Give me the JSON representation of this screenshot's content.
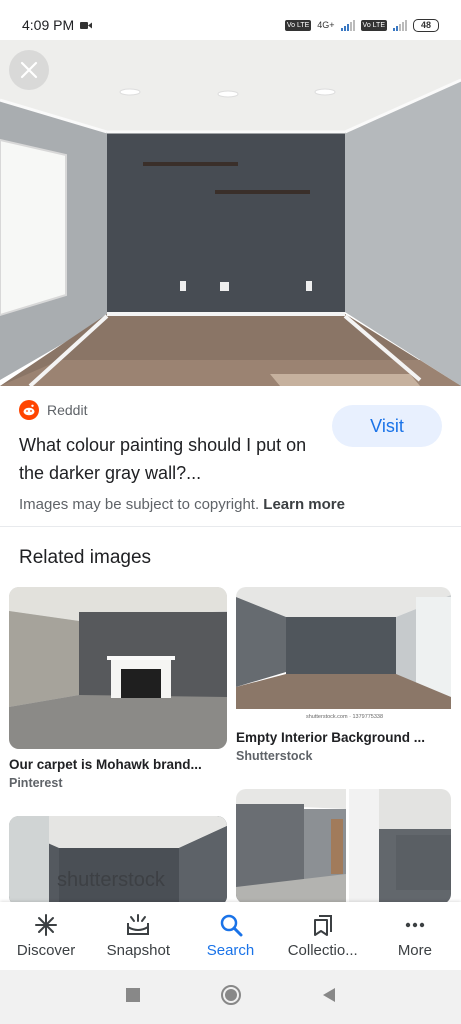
{
  "status_bar": {
    "time": "4:09 PM",
    "volte1": "Vo LTE",
    "volte2": "Vo LTE",
    "net": "4G+",
    "battery": "48"
  },
  "result": {
    "source": "Reddit",
    "title": "What colour painting should I put on the darker gray wall?...",
    "visit_label": "Visit",
    "copyright_text": "Images may be subject to copyright.",
    "learn_more": "Learn more"
  },
  "related": {
    "heading": "Related images",
    "items": [
      {
        "caption": "Our carpet is Mohawk brand...",
        "source": "Pinterest"
      },
      {
        "caption": "Empty Interior Background ...",
        "source": "Shutterstock",
        "watermark": "shutterstock.com · 1379775338"
      },
      {
        "watermark": "shutterstock"
      },
      {}
    ]
  },
  "bottom_nav": {
    "items": [
      {
        "label": "Discover",
        "icon": "discover-icon"
      },
      {
        "label": "Snapshot",
        "icon": "snapshot-icon"
      },
      {
        "label": "Search",
        "icon": "search-icon",
        "active": true
      },
      {
        "label": "Collectio...",
        "icon": "collections-icon"
      },
      {
        "label": "More",
        "icon": "more-icon"
      }
    ]
  },
  "colors": {
    "accent": "#1a73e8",
    "reddit": "#ff4500",
    "visit_bg": "#e8f0fe",
    "wall_dark": "#474c53",
    "wall_light": "#a7abae"
  }
}
